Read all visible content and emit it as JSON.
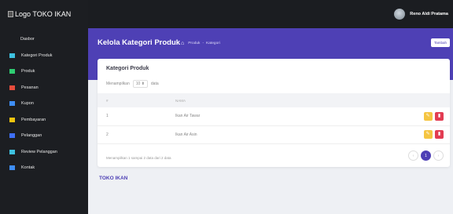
{
  "app": {
    "logo_text": "Logo TOKO IKAN"
  },
  "user": {
    "name": "Reno Aldi Pratama"
  },
  "sidebar": {
    "items": [
      {
        "label": "Dasbor",
        "icon": "none"
      },
      {
        "label": "Kategori Produk",
        "icon": "grid-icon",
        "color": "#3ec1e0"
      },
      {
        "label": "Produk",
        "icon": "cart-icon",
        "color": "#2ecc71"
      },
      {
        "label": "Pesanan",
        "icon": "bag-icon",
        "color": "#e74c3c"
      },
      {
        "label": "Kupon",
        "icon": "ticket-icon",
        "color": "#3e8ef7"
      },
      {
        "label": "Pembayaran",
        "icon": "credit-card-icon",
        "color": "#f1c40f"
      },
      {
        "label": "Pelanggan",
        "icon": "users-icon",
        "color": "#3e6ff7"
      },
      {
        "label": "Review Pelanggan",
        "icon": "comment-icon",
        "color": "#3ec1e0"
      },
      {
        "label": "Kontak",
        "icon": "phone-icon",
        "color": "#3e8ef7"
      }
    ]
  },
  "header": {
    "title": "Kelola Kategori Produk",
    "breadcrumb": [
      "Produk",
      "Kategori"
    ],
    "add_button": "Tambah"
  },
  "card": {
    "title": "Kategori Produk",
    "show_label": "Menampilkan",
    "show_value": "10",
    "show_suffix": "data",
    "columns": [
      "#",
      "NAMA",
      ""
    ],
    "rows": [
      {
        "no": "1",
        "name": "Ikan Air Tawar"
      },
      {
        "no": "2",
        "name": "Ikan Air Asin"
      }
    ],
    "info": "Menampilkan 1 sampai 2 data dari 2 data",
    "pagination": {
      "prev": "‹",
      "current": "1",
      "next": "›"
    }
  },
  "footer": {
    "brand": "TOKO IKAN"
  },
  "colors": {
    "accent": "#4e40b5",
    "sidebar_bg": "#1c1e22",
    "edit": "#f5c542",
    "delete": "#e23c52"
  }
}
